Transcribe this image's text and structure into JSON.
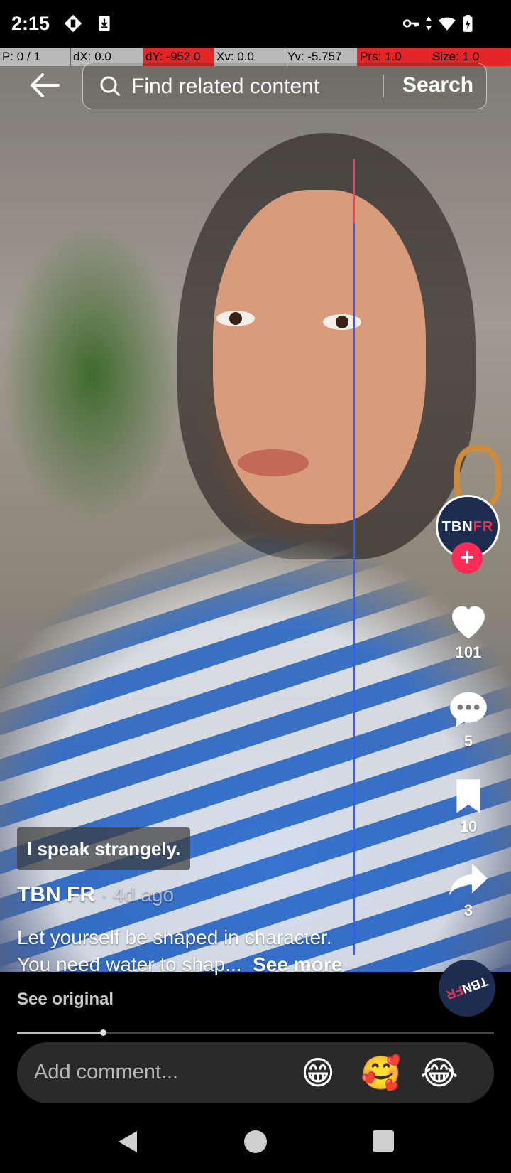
{
  "status_bar": {
    "time": "2:15",
    "icons_left": [
      "screen-rotate-icon",
      "download-icon"
    ],
    "icons_right": [
      "vpn-key-icon",
      "data-arrows-icon",
      "wifi-icon",
      "battery-charging-icon"
    ]
  },
  "debug_overlay": [
    {
      "label": "P: 0 / 1",
      "color": "#b9b9b9"
    },
    {
      "label": "dX: 0.0",
      "color": "#b9b9b9"
    },
    {
      "label": "dY: -952.0",
      "color": "#e52525"
    },
    {
      "label": "Xv: 0.0",
      "color": "#b9b9b9"
    },
    {
      "label": "Yv: -5.757",
      "color": "#b9b9b9"
    },
    {
      "label": "Prs: 1.0",
      "color": "#e52525"
    },
    {
      "label": "Size: 1.0",
      "color": "#e52525"
    }
  ],
  "search": {
    "placeholder": "Find related content",
    "button_label": "Search"
  },
  "creator": {
    "avatar_text_white": "TBN",
    "avatar_text_accent": "FR",
    "accent_color": "#fe2c55"
  },
  "actions": {
    "likes": "101",
    "comments": "5",
    "saves": "10",
    "shares": "3"
  },
  "video": {
    "caption_badge": "I speak strangely.",
    "author": "TBN FR",
    "posted": "· 4d ago",
    "description_line1": "Let yourself be shaped in character.",
    "description_line2": "You need water to shap...",
    "see_more": "See more",
    "see_original": "See original",
    "progress_fraction": 0.18
  },
  "comment_bar": {
    "placeholder": "Add comment...",
    "emojis": [
      "😁",
      "🥰",
      "😂"
    ]
  },
  "nav": {
    "buttons": [
      "back-nav-icon",
      "home-nav-icon",
      "recents-nav-icon"
    ]
  }
}
